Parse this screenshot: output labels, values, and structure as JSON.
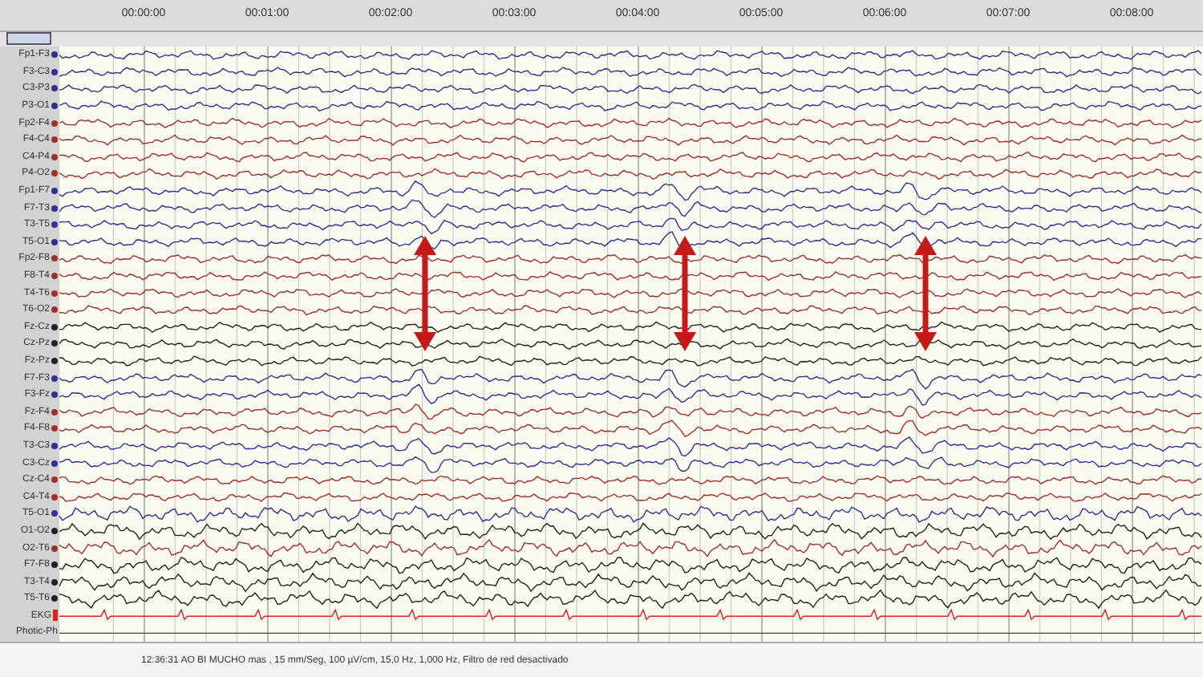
{
  "time_ruler": {
    "times": [
      "00:00:00",
      "00:01:00",
      "00:02:00",
      "00:03:00",
      "00:04:00",
      "00:05:00",
      "00:06:00",
      "00:07:00",
      "00:08:00"
    ]
  },
  "channels": [
    {
      "name": "Fp1-F3",
      "color": "#2e3192"
    },
    {
      "name": "F3-C3",
      "color": "#2e3192"
    },
    {
      "name": "C3-P3",
      "color": "#2e3192"
    },
    {
      "name": "P3-O1",
      "color": "#2e3192"
    },
    {
      "name": "Fp2-F4",
      "color": "#a0302a"
    },
    {
      "name": "F4-C4",
      "color": "#a0302a"
    },
    {
      "name": "C4-P4",
      "color": "#a0302a"
    },
    {
      "name": "P4-O2",
      "color": "#a0302a"
    },
    {
      "name": "Fp1-F7",
      "color": "#2e3192"
    },
    {
      "name": "F7-T3",
      "color": "#2e3192"
    },
    {
      "name": "T3-T5",
      "color": "#2e3192"
    },
    {
      "name": "T5-O1",
      "color": "#2e3192"
    },
    {
      "name": "Fp2-F8",
      "color": "#a0302a"
    },
    {
      "name": "F8-T4",
      "color": "#a0302a"
    },
    {
      "name": "T4-T6",
      "color": "#a0302a"
    },
    {
      "name": "T6-O2",
      "color": "#a0302a"
    },
    {
      "name": "Fz-Cz",
      "color": "#222222"
    },
    {
      "name": "Cz-Pz",
      "color": "#222222"
    },
    {
      "name": "Fz-Pz",
      "color": "#222222"
    },
    {
      "name": "F7-F3",
      "color": "#2e3192"
    },
    {
      "name": "F3-Fz",
      "color": "#2e3192"
    },
    {
      "name": "Fz-F4",
      "color": "#a0302a"
    },
    {
      "name": "F4-F8",
      "color": "#a0302a"
    },
    {
      "name": "T3-C3",
      "color": "#2e3192"
    },
    {
      "name": "C3-Cz",
      "color": "#2e3192"
    },
    {
      "name": "Cz-C4",
      "color": "#a0302a"
    },
    {
      "name": "C4-T4",
      "color": "#a0302a"
    },
    {
      "name": "T5-O1",
      "color": "#2e3192"
    },
    {
      "name": "O1-O2",
      "color": "#222222"
    },
    {
      "name": "O2-T6",
      "color": "#a0302a"
    },
    {
      "name": "F7-F8",
      "color": "#222222"
    },
    {
      "name": "T3-T4",
      "color": "#222222"
    },
    {
      "name": "T5-T6",
      "color": "#222222"
    },
    {
      "name": "EKG",
      "color": "#e02020",
      "kind": "ekg"
    },
    {
      "name": "Photic-Ph",
      "kind": "photic"
    }
  ],
  "status_bar": {
    "text": "12:36:31 AO BI MUCHO mas , 15 mm/Seg, 100 µV/cm, 15,0 Hz, 1,000 Hz, Filtro de red desactivado"
  }
}
